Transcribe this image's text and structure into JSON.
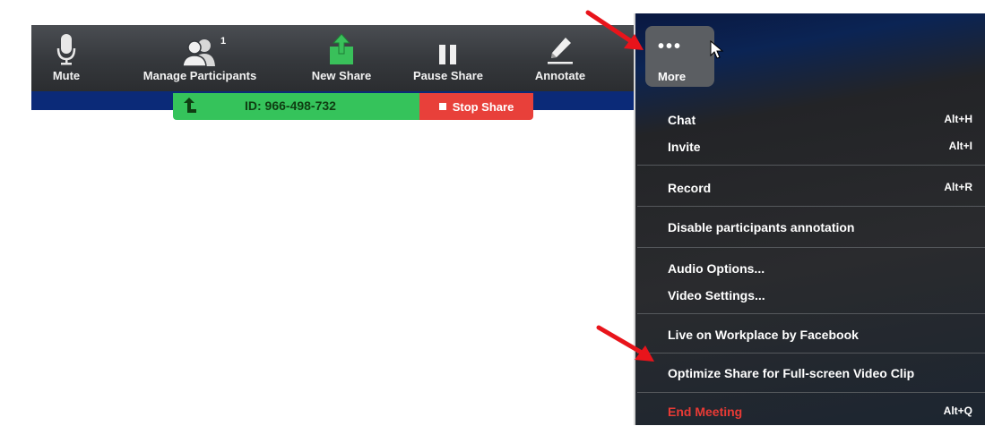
{
  "toolbar": {
    "mute": "Mute",
    "manage_participants": "Manage Participants",
    "participants_count": "1",
    "new_share": "New Share",
    "pause_share": "Pause Share",
    "annotate": "Annotate"
  },
  "share_bar": {
    "meeting_id": "ID: 966-498-732",
    "stop_share": "Stop Share"
  },
  "more": {
    "dots": "•••",
    "label": "More"
  },
  "menu": {
    "chat": {
      "label": "Chat",
      "shortcut": "Alt+H"
    },
    "invite": {
      "label": "Invite",
      "shortcut": "Alt+I"
    },
    "record": {
      "label": "Record",
      "shortcut": "Alt+R"
    },
    "disable_annotation": {
      "label": "Disable participants annotation"
    },
    "audio_options": {
      "label": "Audio Options..."
    },
    "video_settings": {
      "label": "Video Settings..."
    },
    "live_workplace": {
      "label": "Live on Workplace by Facebook"
    },
    "optimize_share": {
      "label": "Optimize Share for Full-screen Video Clip"
    },
    "end_meeting": {
      "label": "End Meeting",
      "shortcut": "Alt+Q"
    }
  },
  "colors": {
    "toolbar_bg": "#35383c",
    "share_green": "#35c35b",
    "stop_red": "#e8403a",
    "panel_bg": "#2a2b2e",
    "end_meeting_red": "#e83a35",
    "annotation_arrow": "#e8141b"
  },
  "icons": [
    "microphone-icon",
    "participants-icon",
    "share-arrow-icon",
    "pause-icon",
    "pencil-icon",
    "ellipsis-icon",
    "cursor-icon",
    "red-arrow-icon"
  ]
}
